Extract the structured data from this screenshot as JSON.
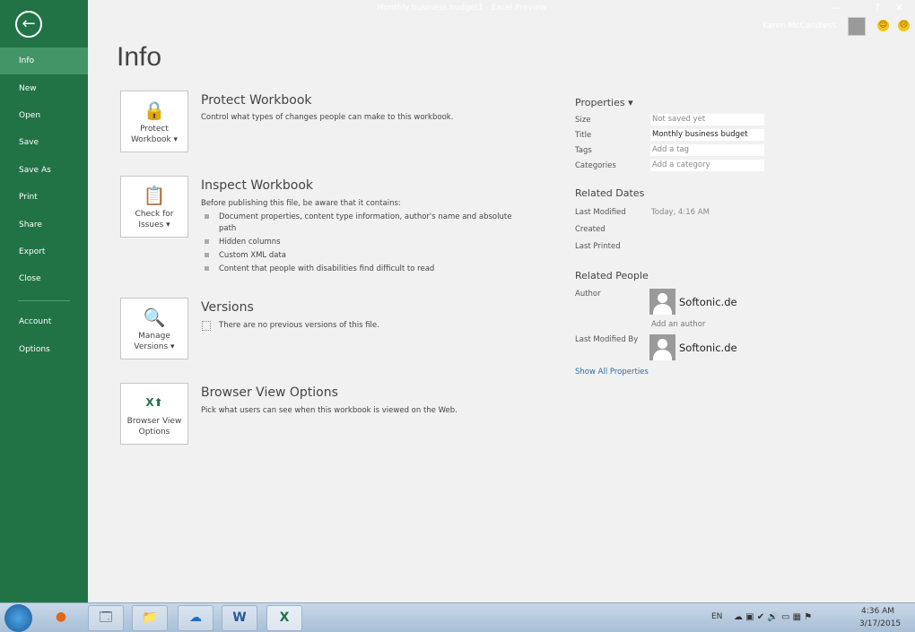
{
  "window": {
    "title": "Monthly business budget1 - Excel Preview",
    "user": "Karen McCandless",
    "help": "?",
    "minimize": "—",
    "restore": "❐",
    "close": "✕"
  },
  "sidebar": {
    "back": "←",
    "items": [
      {
        "label": "Info"
      },
      {
        "label": "New"
      },
      {
        "label": "Open"
      },
      {
        "label": "Save"
      },
      {
        "label": "Save As"
      },
      {
        "label": "Print"
      },
      {
        "label": "Share"
      },
      {
        "label": "Export"
      },
      {
        "label": "Close"
      },
      {
        "label": "Account"
      },
      {
        "label": "Options"
      }
    ]
  },
  "page_title": "Info",
  "sections": [
    {
      "button": [
        "Protect",
        "Workbook ▾"
      ],
      "icon": "lock-key-icon",
      "heading": "Protect Workbook",
      "text": "Control what types of changes people can make to this workbook."
    },
    {
      "button": [
        "Check for",
        "Issues ▾"
      ],
      "icon": "inspect-document-icon",
      "heading": "Inspect Workbook",
      "text": "Before publishing this file, be aware that it contains:",
      "bullets": [
        "Document properties, content type information, author's name and absolute path",
        "Hidden columns",
        "Custom XML data",
        "Content that people with disabilities find difficult to read"
      ]
    },
    {
      "button": [
        "Manage",
        "Versions ▾"
      ],
      "icon": "versions-icon",
      "heading": "Versions",
      "text": "There are no previous versions of this file."
    },
    {
      "button": [
        "Browser View",
        "Options"
      ],
      "icon": "browser-view-icon",
      "heading": "Browser View Options",
      "text": "Pick what users can see when this workbook is viewed on the Web."
    }
  ],
  "properties": {
    "heading": "Properties ▾",
    "rows": [
      {
        "label": "Size",
        "value": "Not saved yet"
      },
      {
        "label": "Title",
        "value": "Monthly business budget"
      },
      {
        "label": "Tags",
        "value": "Add a tag"
      },
      {
        "label": "Categories",
        "value": "Add a category"
      }
    ]
  },
  "related_dates": {
    "heading": "Related Dates",
    "rows": [
      {
        "label": "Last Modified",
        "value": "Today, 4:16 AM"
      },
      {
        "label": "Created",
        "value": ""
      },
      {
        "label": "Last Printed",
        "value": ""
      }
    ]
  },
  "related_people": {
    "heading": "Related People",
    "author_label": "Author",
    "author": "Softonic.de",
    "add_author": "Add an author",
    "modified_label": "Last Modified By",
    "modified_by": "Softonic.de",
    "show_all": "Show All Properties"
  },
  "taskbar": {
    "lang": "EN",
    "time": "4:36 AM",
    "date": "3/17/2015"
  }
}
